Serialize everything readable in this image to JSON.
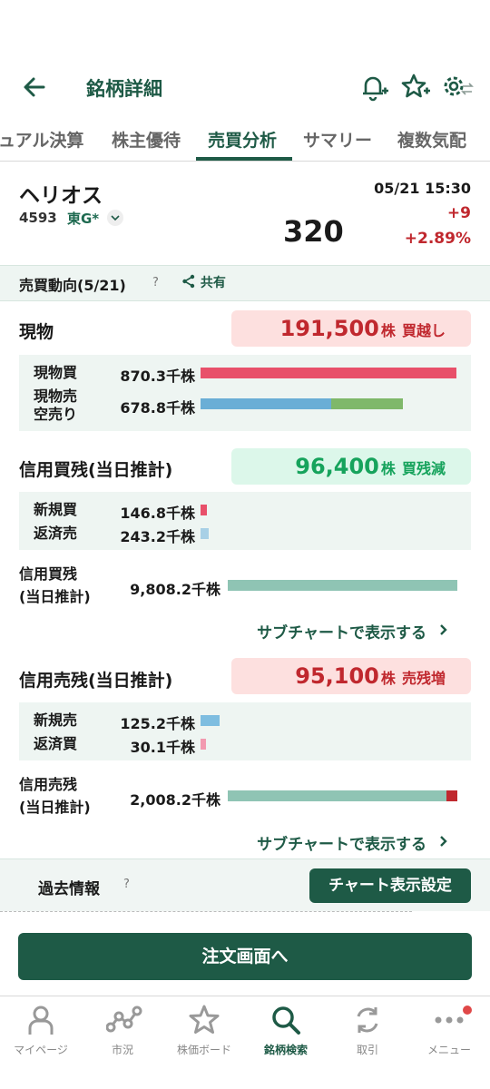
{
  "header": {
    "title": "銘柄詳細"
  },
  "tabs": [
    {
      "label": "ュアル決算"
    },
    {
      "label": "株主優待"
    },
    {
      "label": "売買分析"
    },
    {
      "label": "サマリー"
    },
    {
      "label": "複数気配"
    }
  ],
  "stock": {
    "name": "ヘリオス",
    "code": "4593",
    "market": "東G*",
    "price": "320",
    "datetime": "05/21 15:30",
    "change": "+9",
    "change_pct": "+2.89%"
  },
  "trend": {
    "title": "売買動向(5/21)",
    "help": "?",
    "share_label": "共有"
  },
  "spot": {
    "title": "現物",
    "badge_num": "191,500",
    "badge_unit": "株",
    "badge_label": "買越し",
    "rows": [
      {
        "label": "現物買",
        "value": "870.3千株",
        "ratio": 1.0
      },
      {
        "label": "現物売\n空売り",
        "value": "678.8千株",
        "ratio_a": 0.51,
        "ratio_b": 0.28
      }
    ]
  },
  "margin_buy": {
    "title": "信用買残(当日推計)",
    "badge_num": "96,400",
    "badge_unit": "株",
    "badge_label": "買残減",
    "rows": [
      {
        "label": "新規買",
        "value": "146.8千株"
      },
      {
        "label": "返済売",
        "value": "243.2千株"
      }
    ],
    "total_label_1": "信用買残",
    "total_label_2": "(当日推計)",
    "total_value": "9,808.2千株",
    "subchart_link": "サブチャートで表示する"
  },
  "margin_sell": {
    "title": "信用売残(当日推計)",
    "badge_num": "95,100",
    "badge_unit": "株",
    "badge_label": "売残増",
    "rows": [
      {
        "label": "新規売",
        "value": "125.2千株"
      },
      {
        "label": "返済買",
        "value": "30.1千株"
      }
    ],
    "total_label_1": "信用売残",
    "total_label_2": "(当日推計)",
    "total_value": "2,008.2千株",
    "subchart_link": "サブチャートで表示する"
  },
  "past": {
    "title": "過去情報",
    "help": "?",
    "chart_button": "チャート表示設定"
  },
  "order_button": "注文画面へ",
  "bottom_nav": [
    {
      "label": "マイページ",
      "icon": "person-icon"
    },
    {
      "label": "市況",
      "icon": "market-icon"
    },
    {
      "label": "株価ボード",
      "icon": "star-icon"
    },
    {
      "label": "銘柄検索",
      "icon": "search-icon"
    },
    {
      "label": "取引",
      "icon": "trade-icon"
    },
    {
      "label": "メニュー",
      "icon": "menu-icon"
    }
  ],
  "colors": {
    "brand": "#1e5a46",
    "buy_bar": "#e8506a",
    "sell_bar": "#6aaed6",
    "short_bar": "#7fb86a",
    "margin_bar": "#8fc4b4",
    "up": "#c0282e",
    "positive": "#16a35c"
  }
}
